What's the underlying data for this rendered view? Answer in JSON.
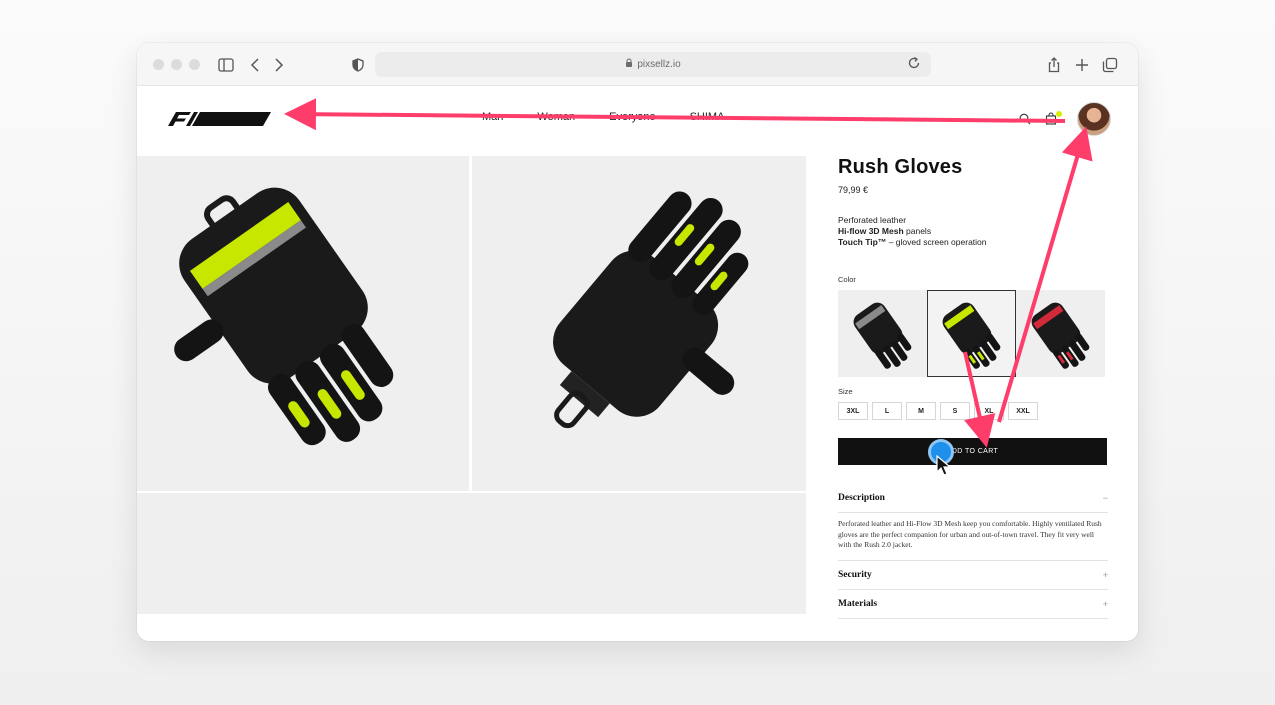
{
  "browser": {
    "url": "pixsellz.io"
  },
  "header": {
    "nav": [
      "Man",
      "Woman",
      "Everyone",
      "SHIMA"
    ]
  },
  "product": {
    "title": "Rush Gloves",
    "price": "79,99 €",
    "features": [
      {
        "bold": "",
        "text": "Perforated leather"
      },
      {
        "bold": "Hi-flow 3D Mesh",
        "text": " panels"
      },
      {
        "bold": "Touch Tip™",
        "text": " – gloved screen operation"
      }
    ],
    "color_label": "Color",
    "colors": [
      {
        "name": "black-grey",
        "accent": "#8a8a8a"
      },
      {
        "name": "black-fluo",
        "accent": "#d6f000"
      },
      {
        "name": "black-red",
        "accent": "#d22a3a"
      }
    ],
    "size_label": "Size",
    "sizes": [
      "3XL",
      "L",
      "M",
      "S",
      "XL",
      "XXL"
    ],
    "add_to_cart": "ADD TO CART",
    "accordion": [
      {
        "title": "Description",
        "sign": "−",
        "body": "Perforated leather and Hi-Flow 3D Mesh keep you comfortable. Highly ventilated Rush gloves are the perfect companion for urban and out-of-town travel. They fit very well with the Rush 2.0 jacket."
      },
      {
        "title": "Security",
        "sign": "+"
      },
      {
        "title": "Materials",
        "sign": "+"
      }
    ]
  },
  "colors": {
    "accent": "#d6f000",
    "annotation_arrow": "#ff3d6b",
    "click_indicator": "#1e8fea",
    "button_bg": "#111111"
  }
}
